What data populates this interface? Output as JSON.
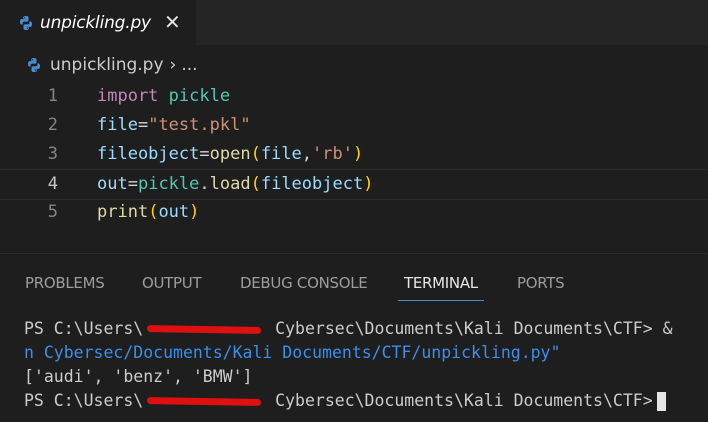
{
  "tab": {
    "filename": "unpickling.py",
    "close": "✕"
  },
  "breadcrumb": {
    "file": "unpickling.py",
    "separator": "›",
    "more": "..."
  },
  "editor": {
    "lines": [
      {
        "number": "1",
        "tokens": [
          [
            "kw",
            "import"
          ],
          [
            "op",
            " "
          ],
          [
            "mod",
            "pickle"
          ]
        ]
      },
      {
        "number": "2",
        "tokens": [
          [
            "var",
            "file"
          ],
          [
            "op",
            "="
          ],
          [
            "str",
            "\"test.pkl\""
          ]
        ]
      },
      {
        "number": "3",
        "tokens": [
          [
            "var",
            "fileobject"
          ],
          [
            "op",
            "="
          ],
          [
            "fn",
            "open"
          ],
          [
            "br",
            "("
          ],
          [
            "var",
            "file"
          ],
          [
            "op",
            ","
          ],
          [
            "str",
            "'rb'"
          ],
          [
            "br",
            ")"
          ]
        ]
      },
      {
        "number": "4",
        "tokens": [
          [
            "var",
            "out"
          ],
          [
            "op",
            "="
          ],
          [
            "mod",
            "pickle"
          ],
          [
            "op",
            "."
          ],
          [
            "fn",
            "load"
          ],
          [
            "br",
            "("
          ],
          [
            "var",
            "fileobject"
          ],
          [
            "br",
            ")"
          ]
        ]
      },
      {
        "number": "5",
        "tokens": [
          [
            "fn",
            "print"
          ],
          [
            "br",
            "("
          ],
          [
            "var",
            "out"
          ],
          [
            "br",
            ")"
          ]
        ]
      }
    ],
    "current_line": 4
  },
  "panel": {
    "tabs": [
      "PROBLEMS",
      "OUTPUT",
      "DEBUG CONSOLE",
      "TERMINAL",
      "PORTS"
    ],
    "active_tab": "TERMINAL"
  },
  "terminal": {
    "line1_prefix": "PS C:\\Users\\",
    "line1_suffix": " Cybersec\\Documents\\Kali Documents\\CTF> &",
    "line2": "n Cybersec/Documents/Kali Documents/CTF/unpickling.py\"",
    "line3": "['audi', 'benz', 'BMW']",
    "line4_prefix": "PS C:\\Users\\",
    "line4_suffix": " Cybersec\\Documents\\Kali Documents\\CTF>"
  },
  "colors": {
    "keyword": "#c586c0",
    "module": "#4ec9b0",
    "variable": "#9cdcfe",
    "string": "#ce9178",
    "function": "#dcdcaa",
    "bracket": "#ffd700",
    "redaction": "#e01010"
  }
}
